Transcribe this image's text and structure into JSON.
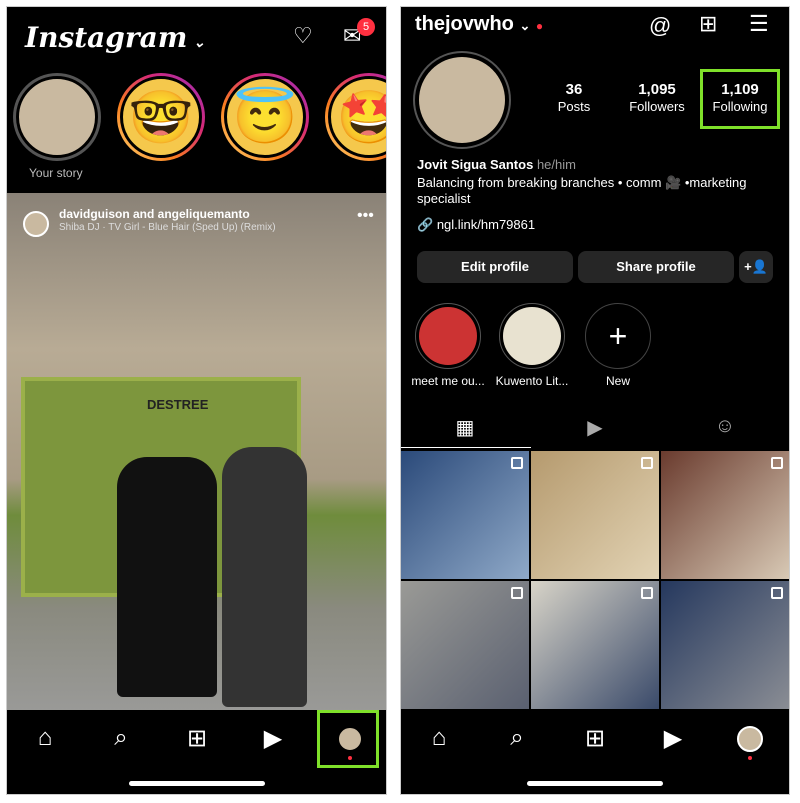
{
  "left": {
    "logo": "Instagram",
    "messages_badge": "5",
    "stories": [
      {
        "label": "Your story",
        "emoji": ""
      },
      {
        "emoji": "🤓"
      },
      {
        "emoji": "😇"
      },
      {
        "emoji": "🤩"
      }
    ],
    "post": {
      "users": "davidguison and angeliquemanto",
      "audio": "Shiba DJ · TV Girl - Blue Hair (Sped Up) (Remix)",
      "sign": "DESTREE"
    },
    "nav": [
      "home-icon",
      "search-icon",
      "create-icon",
      "reels-icon",
      "profile-icon"
    ]
  },
  "right": {
    "username": "thejovwho",
    "stats": [
      {
        "value": "36",
        "label": "Posts"
      },
      {
        "value": "1,095",
        "label": "Followers"
      },
      {
        "value": "1,109",
        "label": "Following"
      }
    ],
    "name": "Jovit Sigua Santos",
    "pronouns": "he/him",
    "bio": "Balancing from breaking branches • comm 🎥 •marketing specialist",
    "link": "ngl.link/hm79861",
    "buttons": {
      "edit": "Edit profile",
      "share": "Share profile"
    },
    "highlights": [
      {
        "label": "meet me ou..."
      },
      {
        "label": "Kuwento Lit..."
      },
      {
        "label": "New"
      }
    ],
    "highlight_color": "#7fe02a"
  }
}
